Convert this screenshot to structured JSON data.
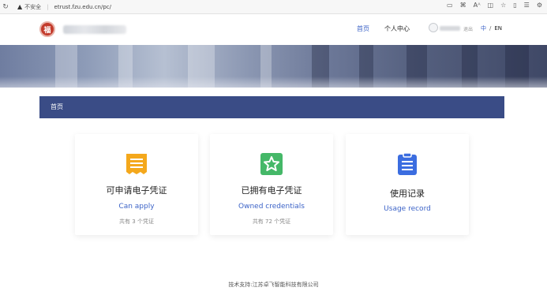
{
  "browser": {
    "security_label": "不安全",
    "url": "etrust.fzu.edu.cn/pc/"
  },
  "header": {
    "logo_char": "福",
    "nav": {
      "home": "首页",
      "personal_center": "个人中心"
    },
    "logout": "退出",
    "lang": {
      "zh": "中",
      "separator": "/",
      "en": "EN"
    }
  },
  "breadcrumb": {
    "current": "首页"
  },
  "cards": [
    {
      "title": "可申请电子凭证",
      "subtitle": "Can apply",
      "count_text": "共有 3 个凭证",
      "icon": "document-list-icon",
      "color": "#f4a81c"
    },
    {
      "title": "已拥有电子凭证",
      "subtitle": "Owned credentials",
      "count_text": "共有 72 个凭证",
      "icon": "star-badge-icon",
      "color": "#45b868"
    },
    {
      "title": "使用记录",
      "subtitle": "Usage record",
      "count_text": "",
      "icon": "clipboard-icon",
      "color": "#3b6de0"
    }
  ],
  "footer": {
    "text": "技术支持:江苏卓飞智能科技有限公司"
  },
  "colors": {
    "accent": "#3c63c7",
    "breadcrumb_bg": "#3a4c86"
  }
}
